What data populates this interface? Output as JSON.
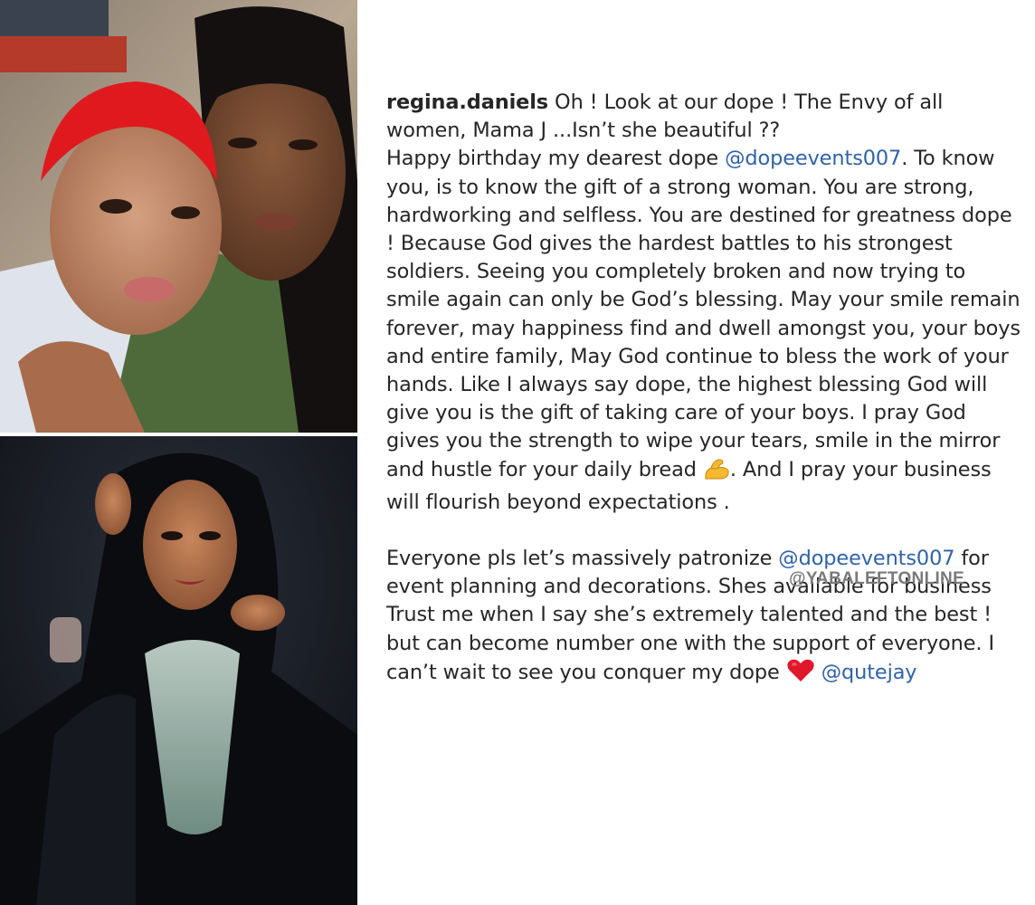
{
  "post": {
    "username": "regina.daniels",
    "caption_line1": " Oh ! Look at our dope ! The Envy of all women, Mama J ...Isn’t she beautiful ??",
    "p2_part1": "Happy birthday my dearest dope ",
    "mention_1": "@dopeevents007",
    "p2_part2": ". To know you, is to know the gift of a strong woman. You are strong, hardworking and selfless. You are destined for greatness dope ! Because God gives the hardest battles to his strongest soldiers. Seeing you completely broken and now trying to smile again can only be God’s blessing. May your smile remain forever, may happiness find and dwell amongst you, your boys and entire family, May God continue to bless the work of your hands. Like I always say dope, the highest blessing God will give you is the gift of taking care of your boys. I pray God gives you the strength to wipe your tears, smile in the mirror and hustle for your daily bread ",
    "emoji_flex": "flexed-biceps-icon",
    "p2_part3": ". And I pray your business will flourish beyond expectations .",
    "p3_part1": "Everyone pls let’s massively patronize ",
    "mention_2": "@dopeevents007",
    "p3_part2": " for event planning and decorations. Shes available for business Trust me when I say she’s extremely talented and the best ! but can become number one with the support of everyone. I can’t wait to see you conquer my dope ",
    "emoji_heart": "red-heart-icon",
    "mention_3": "@qutejay"
  },
  "watermark": "@YABALEFTONLINE",
  "colors": {
    "mention": "#2f62a8",
    "text": "#262626",
    "watermark": "#7a7a7a"
  }
}
